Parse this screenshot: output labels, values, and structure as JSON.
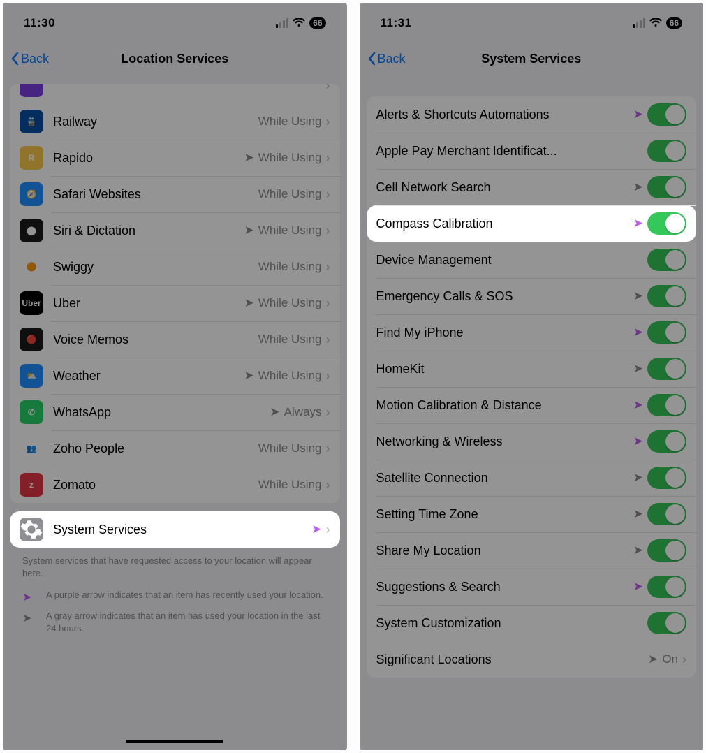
{
  "left": {
    "status": {
      "time": "11:30",
      "battery": "66"
    },
    "nav": {
      "back": "Back",
      "title": "Location Services"
    },
    "apps": [
      {
        "name": "Railway",
        "value": "While Using",
        "arrow": "",
        "iconBg": "#0a4fa0",
        "iconText": "🚆"
      },
      {
        "name": "Rapido",
        "value": "While Using",
        "arrow": "gray",
        "iconBg": "#f7c948",
        "iconText": "R"
      },
      {
        "name": "Safari Websites",
        "value": "While Using",
        "arrow": "",
        "iconBg": "#1e8fff",
        "iconText": "🧭"
      },
      {
        "name": "Siri & Dictation",
        "value": "While Using",
        "arrow": "gray",
        "iconBg": "#1b1b1d",
        "iconText": "⬤"
      },
      {
        "name": "Swiggy",
        "value": "While Using",
        "arrow": "",
        "iconBg": "#ffffff",
        "iconText": "🟠"
      },
      {
        "name": "Uber",
        "value": "While Using",
        "arrow": "gray",
        "iconBg": "#000000",
        "iconText": "Uber"
      },
      {
        "name": "Voice Memos",
        "value": "While Using",
        "arrow": "",
        "iconBg": "#1b1b1d",
        "iconText": "🔴"
      },
      {
        "name": "Weather",
        "value": "While Using",
        "arrow": "gray",
        "iconBg": "#1e8fff",
        "iconText": "⛅"
      },
      {
        "name": "WhatsApp",
        "value": "Always",
        "arrow": "gray",
        "iconBg": "#25d366",
        "iconText": "✆"
      },
      {
        "name": "Zoho People",
        "value": "While Using",
        "arrow": "",
        "iconBg": "#ffffff",
        "iconText": "👥"
      },
      {
        "name": "Zomato",
        "value": "While Using",
        "arrow": "",
        "iconBg": "#e23744",
        "iconText": "z"
      }
    ],
    "system_row": {
      "name": "System Services",
      "arrow": "purple"
    },
    "footer": "System services that have requested access to your location will appear here.",
    "legend_purple": "A purple arrow indicates that an item has recently used your location.",
    "legend_gray": "A gray arrow indicates that an item has used your location in the last 24 hours."
  },
  "right": {
    "status": {
      "time": "11:31",
      "battery": "66"
    },
    "nav": {
      "back": "Back",
      "title": "System Services"
    },
    "services": [
      {
        "name": "Alerts & Shortcuts Automations",
        "arrow": "purple",
        "toggle": true
      },
      {
        "name": "Apple Pay Merchant Identificat...",
        "arrow": "",
        "toggle": true
      },
      {
        "name": "Cell Network Search",
        "arrow": "gray",
        "toggle": true
      },
      {
        "name": "Compass Calibration",
        "arrow": "purple",
        "toggle": true,
        "highlight": true
      },
      {
        "name": "Device Management",
        "arrow": "",
        "toggle": true
      },
      {
        "name": "Emergency Calls & SOS",
        "arrow": "gray",
        "toggle": true
      },
      {
        "name": "Find My iPhone",
        "arrow": "purple",
        "toggle": true
      },
      {
        "name": "HomeKit",
        "arrow": "gray",
        "toggle": true
      },
      {
        "name": "Motion Calibration & Distance",
        "arrow": "purple",
        "toggle": true
      },
      {
        "name": "Networking & Wireless",
        "arrow": "purple",
        "toggle": true
      },
      {
        "name": "Satellite Connection",
        "arrow": "gray",
        "toggle": true
      },
      {
        "name": "Setting Time Zone",
        "arrow": "gray",
        "toggle": true
      },
      {
        "name": "Share My Location",
        "arrow": "gray",
        "toggle": true
      },
      {
        "name": "Suggestions & Search",
        "arrow": "purple",
        "toggle": true
      },
      {
        "name": "System Customization",
        "arrow": "",
        "toggle": true
      }
    ],
    "significant": {
      "name": "Significant Locations",
      "arrow": "gray",
      "value": "On"
    }
  }
}
